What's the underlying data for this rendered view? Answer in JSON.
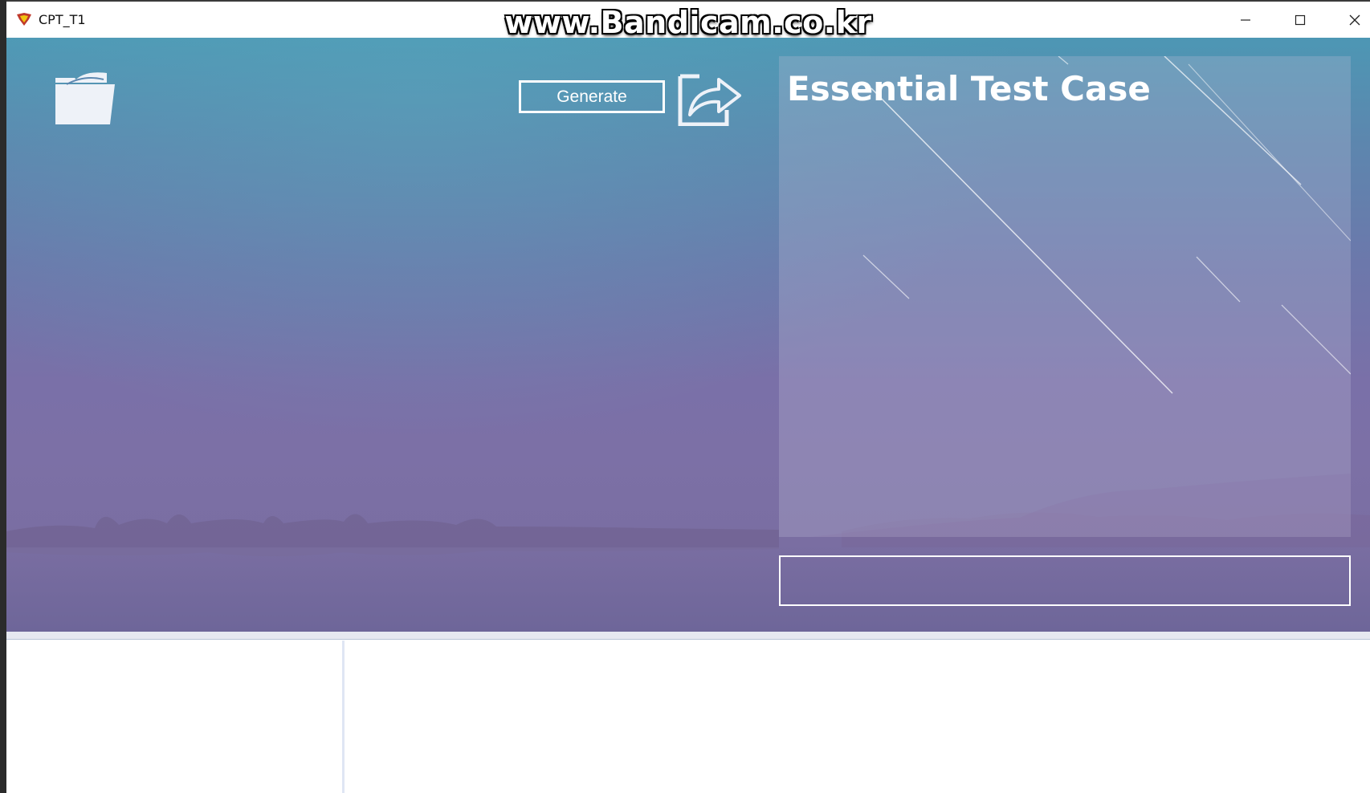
{
  "window": {
    "title": "CPT_T1",
    "watermark": "www.Bandicam.co.kr"
  },
  "toolbar": {
    "generate_label": "Generate",
    "open_icon": "folder-icon",
    "export_icon": "share-arrow-icon"
  },
  "result": {
    "title": "Essential Test Case"
  },
  "input": {
    "value": ""
  },
  "colors": {
    "panel_top": "#4d97b4",
    "panel_bottom": "#7a6ea2",
    "accent": "#ffffff"
  }
}
